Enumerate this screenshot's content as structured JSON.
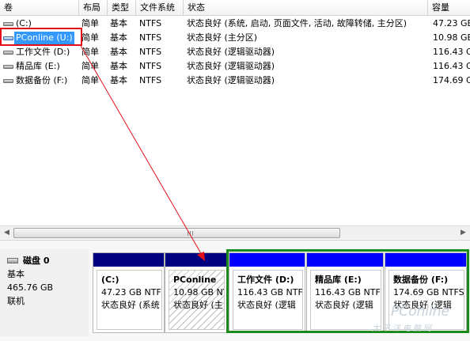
{
  "columns": [
    "卷",
    "布局",
    "类型",
    "文件系统",
    "状态",
    "容量"
  ],
  "volumes": [
    {
      "name": "(C:)",
      "layout": "简单",
      "type": "基本",
      "fs": "NTFS",
      "status": "状态良好 (系统, 启动, 页面文件, 活动, 故障转储, 主分区)",
      "capacity": "47.23 GB"
    },
    {
      "name": "PConline (U:)",
      "layout": "简单",
      "type": "基本",
      "fs": "NTFS",
      "status": "状态良好 (主分区)",
      "capacity": "10.98 GB",
      "selected": true
    },
    {
      "name": "工作文件 (D:)",
      "layout": "简单",
      "type": "基本",
      "fs": "NTFS",
      "status": "状态良好 (逻辑驱动器)",
      "capacity": "116.43 GB"
    },
    {
      "name": "精品库 (E:)",
      "layout": "简单",
      "type": "基本",
      "fs": "NTFS",
      "status": "状态良好 (逻辑驱动器)",
      "capacity": "116.43 GB"
    },
    {
      "name": "数据备份 (F:)",
      "layout": "简单",
      "type": "基本",
      "fs": "NTFS",
      "status": "状态良好 (逻辑驱动器)",
      "capacity": "174.69 GB"
    }
  ],
  "disk": {
    "title": "磁盘 0",
    "type": "基本",
    "size": "465.76 GB",
    "state": "联机"
  },
  "partitions": [
    {
      "name": "(C:)",
      "size": "47.23 GB NTFS",
      "status": "状态良好 (系统",
      "bar_color": "#000080"
    },
    {
      "name": "PConline",
      "size": "10.98 GB NTFS",
      "status": "状态良好 (主",
      "bar_color": "#000080",
      "selected": true
    },
    {
      "name": "工作文件 (D:)",
      "size": "116.43 GB NTFS",
      "status": "状态良好 (逻辑",
      "bar_color": "#0000ff"
    },
    {
      "name": "精品库 (E:)",
      "size": "116.43 GB NTFS",
      "status": "状态良好 (逻辑",
      "bar_color": "#0000ff"
    },
    {
      "name": "数据备份 (F:)",
      "size": "174.69 GB NTFS",
      "status": "状态良好 (逻辑",
      "bar_color": "#0000ff"
    }
  ],
  "watermark": {
    "brand": "PConline",
    "tagline": "太平洋电脑网"
  },
  "annotations": {
    "highlight_color": "#e3101a",
    "group_color": "#1b8a1b",
    "arrow_color": "#e3101a"
  },
  "icons": [
    "hard-drive-icon",
    "disk-icon"
  ]
}
